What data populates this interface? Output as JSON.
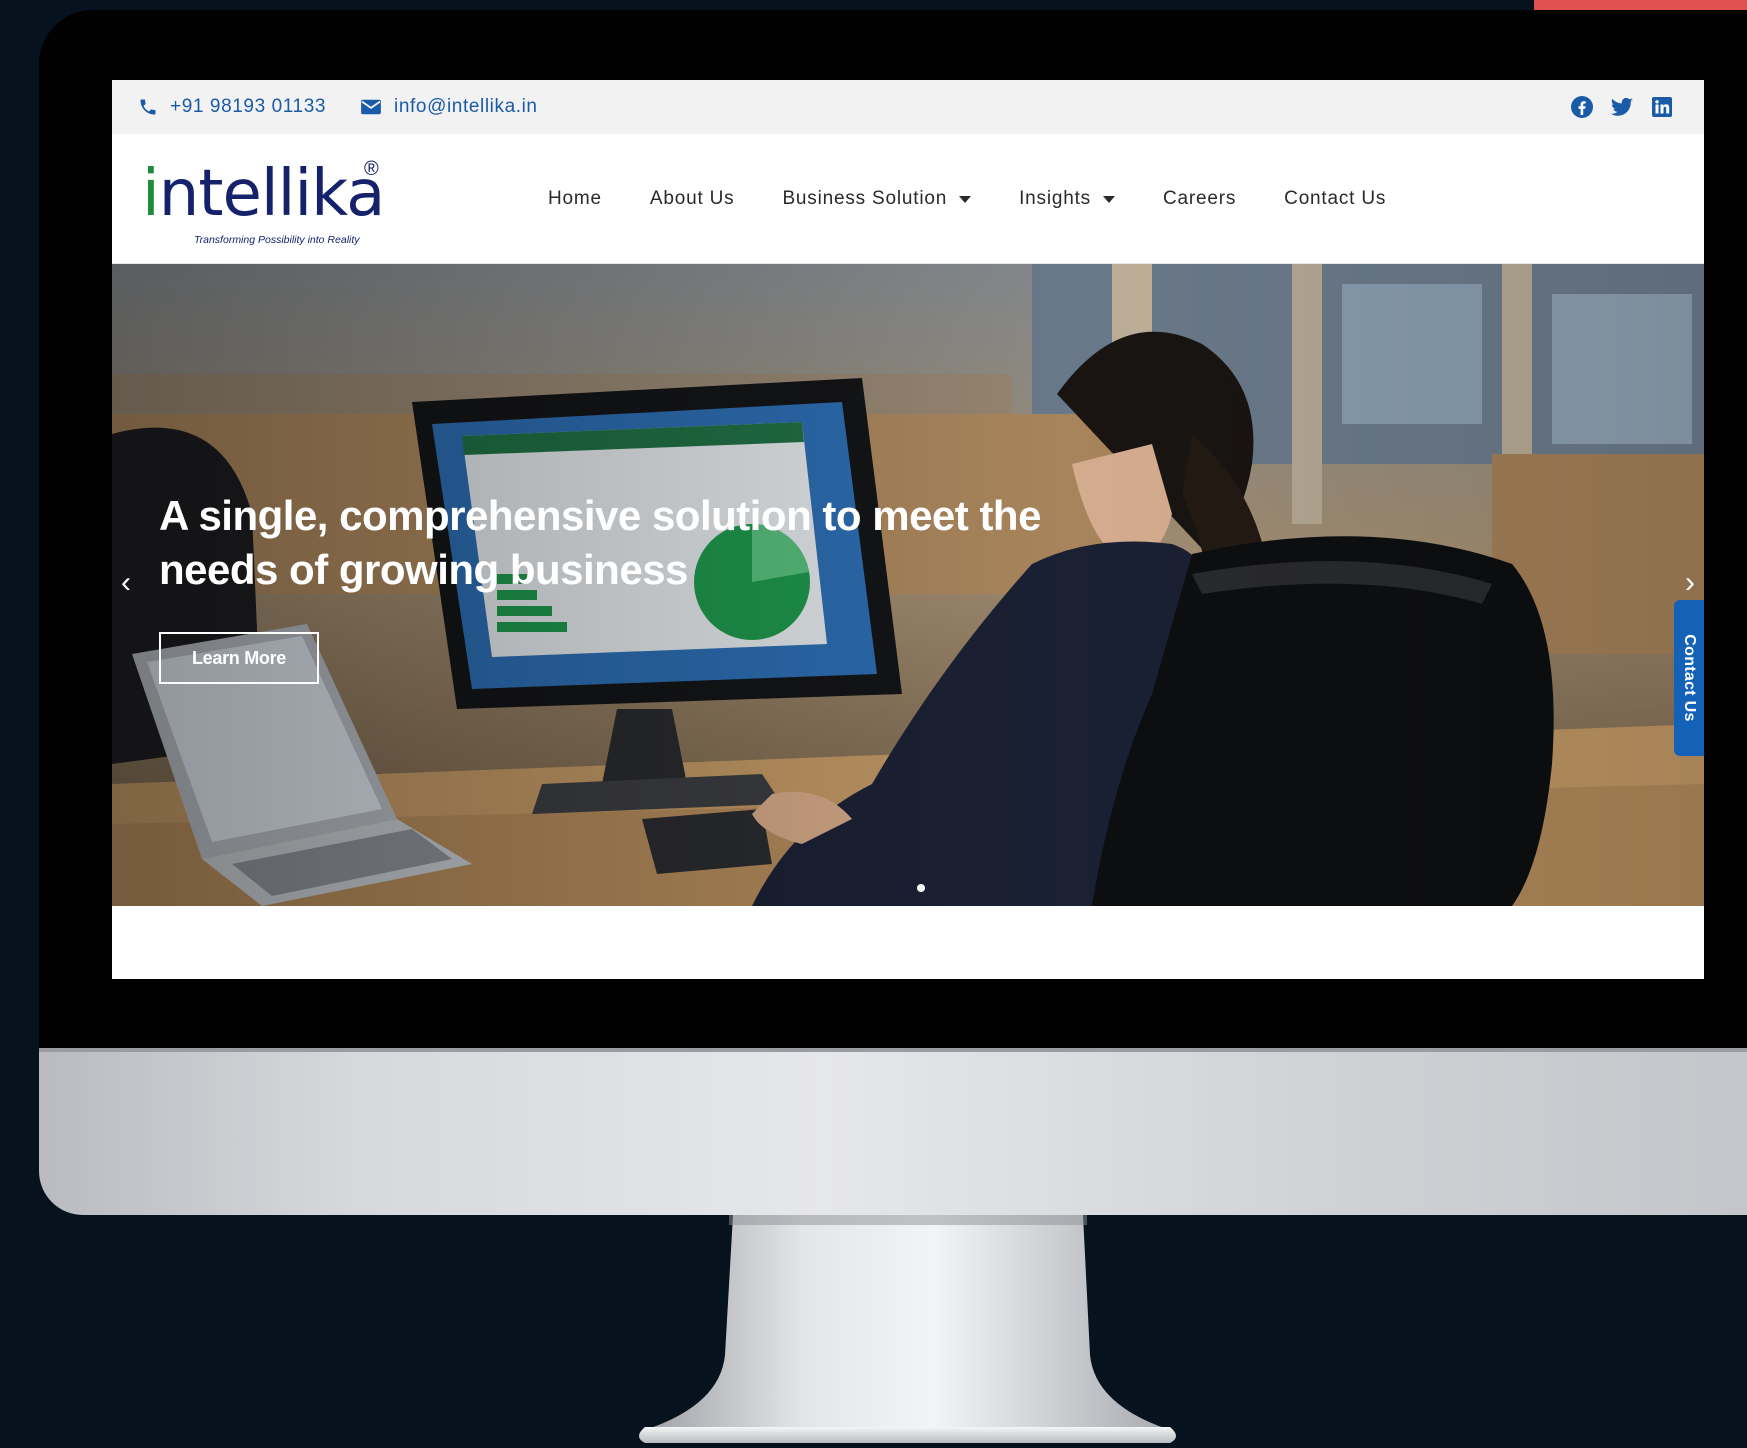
{
  "topbar": {
    "phone": "+91 98193 01133",
    "email": "info@intellika.in",
    "social": [
      "facebook-icon",
      "twitter-icon",
      "linkedin-icon"
    ]
  },
  "logo": {
    "word_prefix": "i",
    "word_rest": "ntellika",
    "registered": "®",
    "tagline": "Transforming Possibility into Reality"
  },
  "nav": {
    "items": [
      {
        "label": "Home"
      },
      {
        "label": "About Us"
      },
      {
        "label": "Business Solution"
      },
      {
        "label": "Insights"
      },
      {
        "label": "Careers"
      },
      {
        "label": "Contact Us"
      }
    ]
  },
  "hero": {
    "title": "A single, comprehensive solution to meet the needs of growing business",
    "cta": "Learn More",
    "prev": "‹",
    "next": "›"
  },
  "contact_tab": "Contact Us",
  "colors": {
    "brand_blue": "#1a5ba8",
    "logo_navy": "#15226b",
    "logo_green": "#1e8a3a",
    "tab_blue": "#1462b8",
    "accent_red": "#e0524f"
  }
}
